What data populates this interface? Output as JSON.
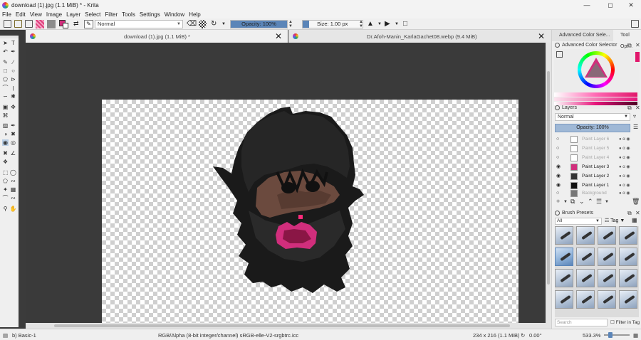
{
  "window": {
    "title": "download (1).jpg (1.1 MiB) * - Krita"
  },
  "menu": [
    "File",
    "Edit",
    "View",
    "Image",
    "Layer",
    "Select",
    "Filter",
    "Tools",
    "Settings",
    "Window",
    "Help"
  ],
  "toolbar": {
    "blend_mode": "Normal",
    "opacity": "Opacity: 100%",
    "opacity_value": 1.0,
    "size": "Size: 1.00 px"
  },
  "tabs": [
    {
      "label": "download (1).jpg (1.1 MiB) *"
    },
    {
      "label": "Dr.Afoh-Manin_KarlaGachet08.webp (9.4 MiB)"
    }
  ],
  "dock": {
    "tabs": [
      "Advanced Color Sele...",
      "Tool Opt..."
    ],
    "color_panel_title": "Advanced Color Selector",
    "layers_title": "Layers",
    "layer_blend": "Normal",
    "layer_opacity": "Opacity:  100%",
    "layers": [
      {
        "name": "Paint Layer 6",
        "visible": false
      },
      {
        "name": "Paint Layer 5",
        "visible": false
      },
      {
        "name": "Paint Layer 4",
        "visible": false
      },
      {
        "name": "Paint Layer 3",
        "visible": true
      },
      {
        "name": "Paint Layer 2",
        "visible": true
      },
      {
        "name": "Paint Layer 1",
        "visible": true
      },
      {
        "name": "Background",
        "visible": false
      }
    ],
    "brush_presets_title": "Brush Presets",
    "brush_filter": "All",
    "brush_tag": "Tag",
    "search_placeholder": "Search",
    "filter_in_tag": "Filter in Tag"
  },
  "status": {
    "brush": "b) Basic-1",
    "color_info": "RGB/Alpha (8-bit integer/channel)  sRGB-elle-V2-srgbtrc.icc",
    "image_size": "234 x 216 (1.1 MiB)",
    "rotation": "0.00°",
    "zoom": "533.3%"
  },
  "colors": {
    "accent": "#5b85b8",
    "foreground": "#d12e7c",
    "background": "#ffffff"
  }
}
